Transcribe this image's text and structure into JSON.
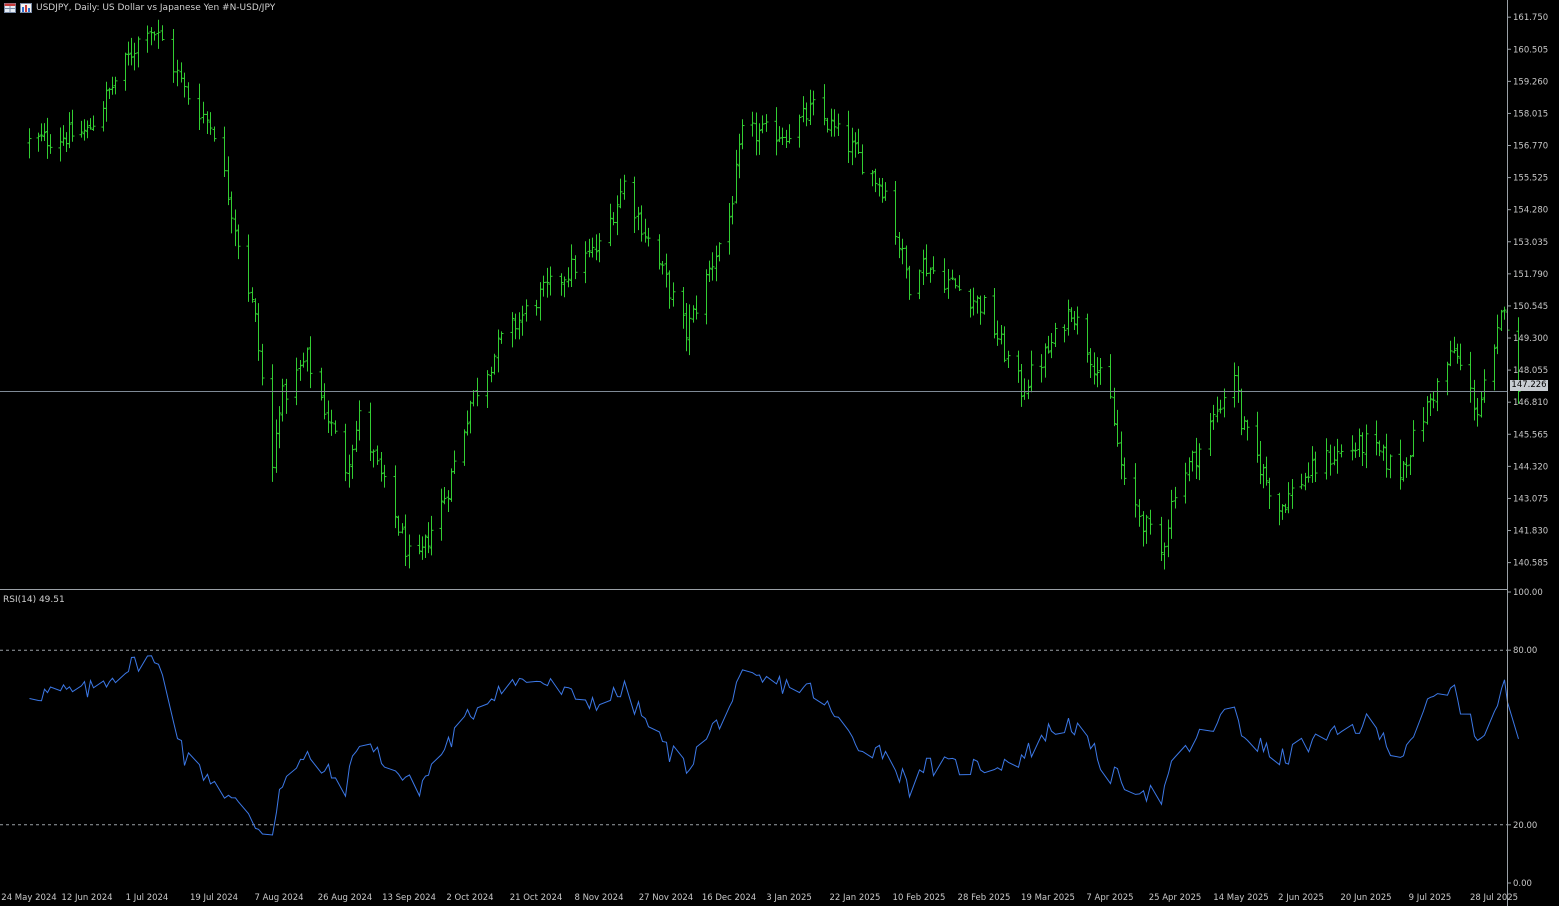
{
  "header": {
    "title": "USDJPY, Daily:  US Dollar vs  Japanese Yen #N-USD/JPY",
    "icon_table": "table-icon",
    "icon_chart": "chart-icon"
  },
  "indicator": {
    "label": "RSI(14) 49.51"
  },
  "current_price_label": "147.226",
  "colors": {
    "background": "#000000",
    "candles": "#32cd32",
    "rsi_line": "#3c78e6",
    "axis_text": "#c8c8c8",
    "price_line": "#7f8a96",
    "price_tag": "#c8cdd2"
  },
  "chart_data": [
    {
      "type": "bar",
      "subtype": "ohlc-bars",
      "symbol": "USDJPY",
      "timeframe": "Daily",
      "ylim": [
        139.6,
        162.3
      ],
      "yticks": [
        "161.750",
        "160.505",
        "159.260",
        "158.015",
        "156.770",
        "155.525",
        "154.280",
        "153.035",
        "151.790",
        "150.545",
        "149.300",
        "148.055",
        "146.810",
        "145.565",
        "144.320",
        "143.075",
        "141.830",
        "140.585"
      ],
      "xticks": [
        "24 May 2024",
        "12 Jun 2024",
        "1 Jul 2024",
        "19 Jul 2024",
        "7 Aug 2024",
        "26 Aug 2024",
        "13 Sep 2024",
        "2 Oct 2024",
        "21 Oct 2024",
        "8 Nov 2024",
        "27 Nov 2024",
        "16 Dec 2024",
        "3 Jan 2025",
        "22 Jan 2025",
        "10 Feb 2025",
        "28 Feb 2025",
        "19 Mar 2025",
        "7 Apr 2025",
        "25 Apr 2025",
        "14 May 2025",
        "2 Jun 2025",
        "20 Jun 2025",
        "9 Jul 2025",
        "28 Jul 2025"
      ],
      "current_price": 147.226,
      "close_anchors": [
        [
          "24 May 2024",
          156.9
        ],
        [
          "12 Jun 2024",
          157.3
        ],
        [
          "1 Jul 2024",
          161.5
        ],
        [
          "5 Jul 2024",
          160.8
        ],
        [
          "11 Jul 2024",
          158.9
        ],
        [
          "19 Jul 2024",
          157.4
        ],
        [
          "31 Jul 2024",
          150.0
        ],
        [
          "5 Aug 2024",
          144.2
        ],
        [
          "7 Aug 2024",
          146.8
        ],
        [
          "15 Aug 2024",
          148.5
        ],
        [
          "26 Aug 2024",
          144.3
        ],
        [
          "30 Aug 2024",
          146.2
        ],
        [
          "13 Sep 2024",
          140.8
        ],
        [
          "16 Sep 2024",
          140.6
        ],
        [
          "25 Sep 2024",
          143.5
        ],
        [
          "2 Oct 2024",
          146.8
        ],
        [
          "11 Oct 2024",
          149.2
        ],
        [
          "21 Oct 2024",
          150.8
        ],
        [
          "31 Oct 2024",
          152.0
        ],
        [
          "8 Nov 2024",
          152.8
        ],
        [
          "15 Nov 2024",
          155.3
        ],
        [
          "27 Nov 2024",
          151.5
        ],
        [
          "3 Dec 2024",
          149.5
        ],
        [
          "16 Dec 2024",
          154.0
        ],
        [
          "20 Dec 2024",
          157.2
        ],
        [
          "3 Jan 2025",
          157.3
        ],
        [
          "10 Jan 2025",
          158.2
        ],
        [
          "22 Jan 2025",
          156.5
        ],
        [
          "31 Jan 2025",
          155.0
        ],
        [
          "7 Feb 2025",
          151.4
        ],
        [
          "10 Feb 2025",
          152.3
        ],
        [
          "28 Feb 2025",
          150.5
        ],
        [
          "11 Mar 2025",
          147.3
        ],
        [
          "19 Mar 2025",
          148.8
        ],
        [
          "26 Mar 2025",
          150.5
        ],
        [
          "7 Apr 2025",
          146.8
        ],
        [
          "11 Apr 2025",
          143.5
        ],
        [
          "21 Apr 2025",
          140.9
        ],
        [
          "25 Apr 2025",
          143.5
        ],
        [
          "2 May 2025",
          145.0
        ],
        [
          "12 May 2025",
          148.0
        ],
        [
          "14 May 2025",
          146.0
        ],
        [
          "26 May 2025",
          142.7
        ],
        [
          "2 Jun 2025",
          143.8
        ],
        [
          "10 Jun 2025",
          144.7
        ],
        [
          "20 Jun 2025",
          145.2
        ],
        [
          "30 Jun 2025",
          144.1
        ],
        [
          "9 Jul 2025",
          146.9
        ],
        [
          "16 Jul 2025",
          148.8
        ],
        [
          "23 Jul 2025",
          146.5
        ],
        [
          "28 Jul 2025",
          148.6
        ],
        [
          "31 Jul 2025",
          150.8
        ],
        [
          "4 Aug 2025",
          147.2
        ]
      ]
    },
    {
      "type": "line",
      "series": [
        {
          "name": "RSI(14)",
          "last_value": 49.51
        }
      ],
      "ylim": [
        0,
        100
      ],
      "yticks": [
        "100.00",
        "80.00",
        "20.00",
        "0.00"
      ],
      "levels": [
        80,
        20
      ],
      "rsi_anchors": [
        [
          "24 May 2024",
          65
        ],
        [
          "12 Jun 2024",
          66
        ],
        [
          "1 Jul 2024",
          78
        ],
        [
          "5 Jul 2024",
          72
        ],
        [
          "11 Jul 2024",
          43
        ],
        [
          "19 Jul 2024",
          35
        ],
        [
          "31 Jul 2024",
          20
        ],
        [
          "5 Aug 2024",
          17
        ],
        [
          "7 Aug 2024",
          34
        ],
        [
          "15 Aug 2024",
          43
        ],
        [
          "26 Aug 2024",
          33
        ],
        [
          "30 Aug 2024",
          50
        ],
        [
          "13 Sep 2024",
          34
        ],
        [
          "16 Sep 2024",
          33
        ],
        [
          "25 Sep 2024",
          48
        ],
        [
          "2 Oct 2024",
          58
        ],
        [
          "11 Oct 2024",
          68
        ],
        [
          "21 Oct 2024",
          70
        ],
        [
          "31 Oct 2024",
          64
        ],
        [
          "8 Nov 2024",
          62
        ],
        [
          "15 Nov 2024",
          66
        ],
        [
          "27 Nov 2024",
          46
        ],
        [
          "3 Dec 2024",
          40
        ],
        [
          "16 Dec 2024",
          61
        ],
        [
          "20 Dec 2024",
          70
        ],
        [
          "3 Jan 2025",
          68
        ],
        [
          "10 Jan 2025",
          66
        ],
        [
          "22 Jan 2025",
          48
        ],
        [
          "31 Jan 2025",
          45
        ],
        [
          "7 Feb 2025",
          33
        ],
        [
          "10 Feb 2025",
          40
        ],
        [
          "28 Feb 2025",
          40
        ],
        [
          "11 Mar 2025",
          43
        ],
        [
          "19 Mar 2025",
          52
        ],
        [
          "26 Mar 2025",
          55
        ],
        [
          "7 Apr 2025",
          37
        ],
        [
          "11 Apr 2025",
          35
        ],
        [
          "21 Apr 2025",
          29
        ],
        [
          "25 Apr 2025",
          42
        ],
        [
          "2 May 2025",
          50
        ],
        [
          "12 May 2025",
          60
        ],
        [
          "14 May 2025",
          52
        ],
        [
          "26 May 2025",
          42
        ],
        [
          "2 Jun 2025",
          47
        ],
        [
          "10 Jun 2025",
          50
        ],
        [
          "20 Jun 2025",
          55
        ],
        [
          "30 Jun 2025",
          44
        ],
        [
          "9 Jul 2025",
          62
        ],
        [
          "16 Jul 2025",
          66
        ],
        [
          "23 Jul 2025",
          50
        ],
        [
          "28 Jul 2025",
          58
        ],
        [
          "31 Jul 2025",
          68
        ],
        [
          "4 Aug 2025",
          49.5
        ]
      ]
    }
  ]
}
